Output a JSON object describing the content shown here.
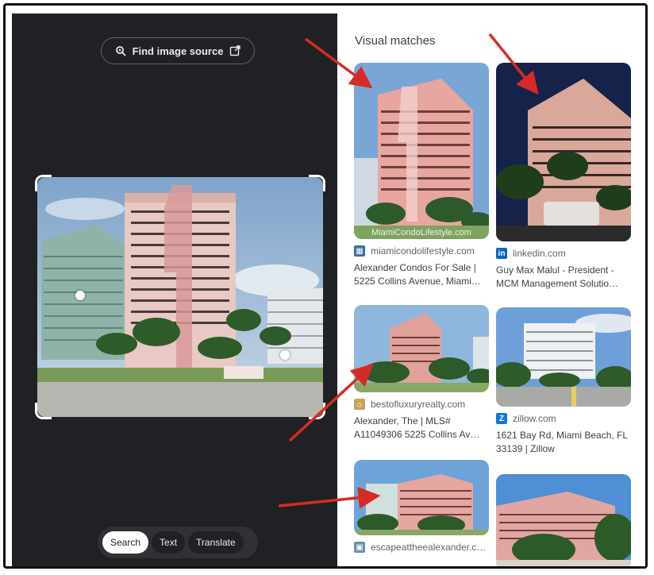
{
  "left_panel": {
    "find_source_label": "Find image source",
    "modes": [
      {
        "label": "Search",
        "active": true
      },
      {
        "label": "Text",
        "active": false
      },
      {
        "label": "Translate",
        "active": false
      }
    ]
  },
  "right_panel": {
    "title": "Visual matches",
    "results": [
      {
        "site": "miamicondolifestyle.com",
        "title": "Alexander Condos For Sale | 5225 Collins Avenue, Miami…",
        "favicon": "building-favicon",
        "watermark": "MiamiCondoLifestyle.com"
      },
      {
        "site": "linkedin.com",
        "title": "Guy Max Malul - President - MCM Management Solutio…",
        "favicon": "linkedin-icon"
      },
      {
        "site": "bestofluxuryrealty.com",
        "title": "Alexander, The | MLS# A11049306 5225 Collins Av…",
        "favicon": "home-favicon"
      },
      {
        "site": "zillow.com",
        "title": "1621 Bay Rd, Miami Beach, FL 33139 | Zillow",
        "favicon": "zillow-icon"
      },
      {
        "site": "escapeattheealexander.c…",
        "title": "",
        "favicon": "photo-favicon"
      },
      {
        "site": "",
        "title": "",
        "favicon": ""
      }
    ]
  },
  "colors": {
    "dark_panel": "#202124",
    "annotation_arrow": "#d62b24",
    "linkedin": "#0a66c2",
    "zillow": "#1277e1"
  }
}
